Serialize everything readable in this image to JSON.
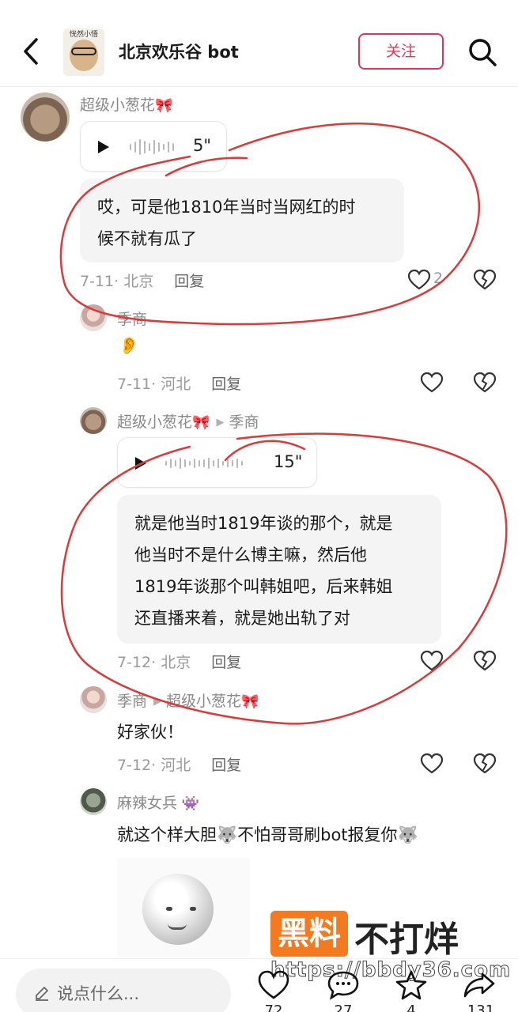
{
  "header": {
    "title": "北京欢乐谷 bot",
    "avatar_caption": "恍然小悟",
    "follow_label": "关注"
  },
  "comments": [
    {
      "user": "超级小葱花",
      "voice_duration": "5\"",
      "text_line1": "哎，可是他1810年当时当网红的时",
      "text_line2": "候不就有瓜了",
      "meta": "7-11· 北京",
      "reply_label": "回复",
      "likes": "2"
    },
    {
      "user": "季商",
      "text": "👂",
      "meta": "7-11· 河北",
      "reply_label": "回复"
    },
    {
      "user": "超级小葱花",
      "reply_to": "季商",
      "voice_duration": "15\"",
      "text_line1": "就是他当时1819年谈的那个，就是",
      "text_line2": "他当时不是什么博主嘛，然后他",
      "text_line3": "1819年谈那个叫韩姐吧，后来韩姐",
      "text_line4": "还直播来着，就是她出轨了对",
      "meta": "7-12· 北京",
      "reply_label": "回复"
    },
    {
      "user": "季商",
      "reply_to": "超级小葱花",
      "text": "好家伙！",
      "meta": "7-12· 河北",
      "reply_label": "回复"
    },
    {
      "user": "麻辣女兵",
      "text": "就这个样大胆🐺不怕哥哥刷bot报复你🐺"
    }
  ],
  "watermark": {
    "box": "黑料",
    "text": "不打烊",
    "url": "https://bbdy36.com"
  },
  "bottom_bar": {
    "placeholder": "说点什么...",
    "like_count": "72",
    "comment_count": "27",
    "star_count": "4",
    "share_count": "131"
  },
  "colors": {
    "accent": "#e0355a",
    "annotation": "#d93a3a",
    "watermark_orange": "#f47a1f"
  }
}
